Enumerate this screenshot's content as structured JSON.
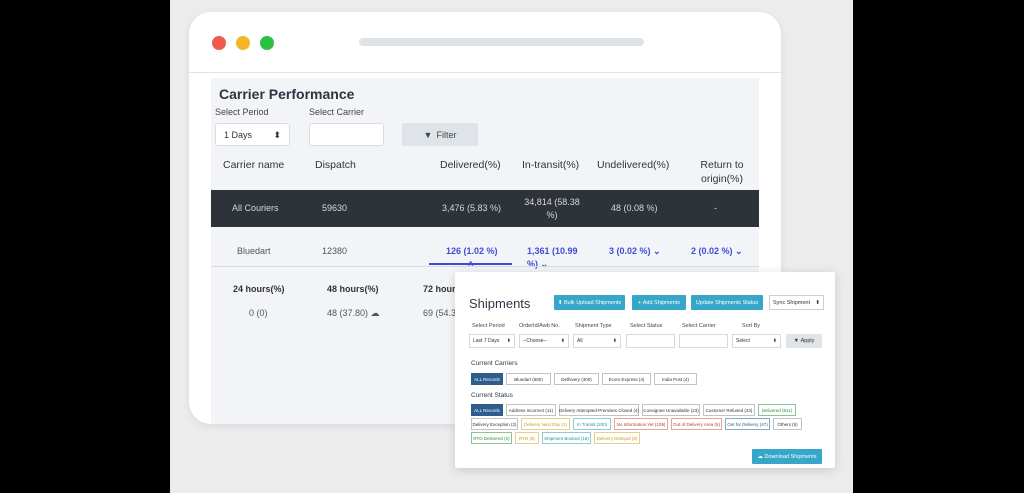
{
  "carrier": {
    "title": "Carrier Performance",
    "period_label": "Select Period",
    "period_value": "1 Days",
    "carrier_label": "Select Carrier",
    "filter_label": "Filter",
    "headers": [
      "Carrier name",
      "Dispatch",
      "Delivered(%)",
      "In-transit(%)",
      "Undelivered(%)",
      "Return to origin(%)"
    ],
    "rows": [
      {
        "name": "All Couriers",
        "dispatch": "59630",
        "delivered": "3,476 (5.83 %)",
        "in_transit": "34,814 (58.38 %)",
        "undelivered": "48 (0.08 %)",
        "rto": "-"
      },
      {
        "name": "Bluedart",
        "dispatch": "12380",
        "delivered": "126 (1.02 %)",
        "in_transit": "1,361 (10.99 %)",
        "undelivered": "3 (0.02 %)",
        "rto": "2 (0.02 %)"
      }
    ],
    "sub_headers": [
      "24 hours(%)",
      "48 hours(%)",
      "72 hours"
    ],
    "sub_row": [
      "0 (0)",
      "48 (37.80)",
      "69 (54.3"
    ]
  },
  "shipments": {
    "title": "Shipments",
    "buttons": [
      "Bulk Upload Shipments",
      "Add Shipments",
      "Update Shipments Status"
    ],
    "sync": "Sync Shipment",
    "filters": [
      {
        "label": "Select Period",
        "value": "Last 7 Days"
      },
      {
        "label": "OrderId/Awb No.",
        "value": ""
      },
      {
        "label": "Shipment Type",
        "value": "All"
      },
      {
        "label": "Select Status",
        "value": ""
      },
      {
        "label": "Select Carrier",
        "value": ""
      },
      {
        "label": "Sort By",
        "value": "Select"
      }
    ],
    "order_value": "--Choose--",
    "apply": "Apply",
    "carriers_title": "Current Carriers",
    "carriers": [
      "ALL Records",
      "Bluedart (680)",
      "Delhivery (300)",
      "Ecom Express (4)",
      "India Post (4)"
    ],
    "status_title": "Current Status",
    "statuses": [
      "ALL Records",
      "Address Incorrect (11)",
      "Delivery Attempted-Premises Closed (4)",
      "Consignee Unavailable (23)",
      "Customer Refused (43)",
      "Delivered (811)",
      "Delivery Exception (2)",
      "Delivery Next Day (1)",
      "In Transit (200)",
      "No Information Yet (109)",
      "Out of Delivery Area (5)",
      "Out for Delivery (47)",
      "Others (5)",
      "RTO Delivered (2)",
      "RTO (8)",
      "Shipment Booked (18)",
      "Delivery Delayed (6)"
    ],
    "download": "Download Shipments"
  }
}
